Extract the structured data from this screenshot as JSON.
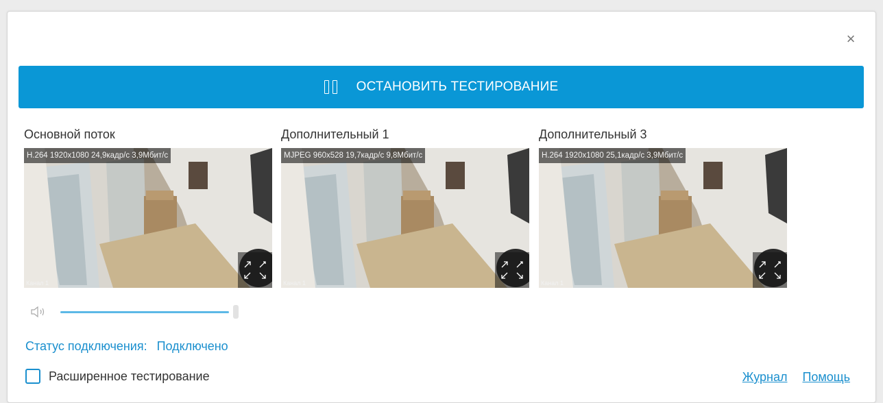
{
  "dialog": {
    "close_glyph": "×",
    "stop_button": {
      "label": "ОСТАНОВИТЬ ТЕСТИРОВАНИЕ",
      "icon": "pause-icon"
    },
    "streams": [
      {
        "title": "Основной поток",
        "info": "H.264 1920x1080 24,9кадр/с 3,9Мбит/с",
        "channel": "Канал 1"
      },
      {
        "title": "Дополнительный 1",
        "info": "MJPEG 960x528 19,7кадр/с 9,8Мбит/с",
        "channel": "Канал 1"
      },
      {
        "title": "Дополнительный 3",
        "info": "H.264 1920x1080 25,1кадр/с 3,9Мбит/с",
        "channel": "Канал 1"
      }
    ],
    "volume": {
      "icon": "speaker-icon",
      "level": 1.0
    },
    "status": {
      "label": "Статус подключения:",
      "value": "Подключено"
    },
    "extended_testing": {
      "label": "Расширенное тестирование",
      "checked": false
    },
    "links": {
      "journal": "Журнал",
      "help": "Помощь"
    }
  },
  "colors": {
    "accent": "#0a97d6",
    "link": "#1a8fce"
  }
}
